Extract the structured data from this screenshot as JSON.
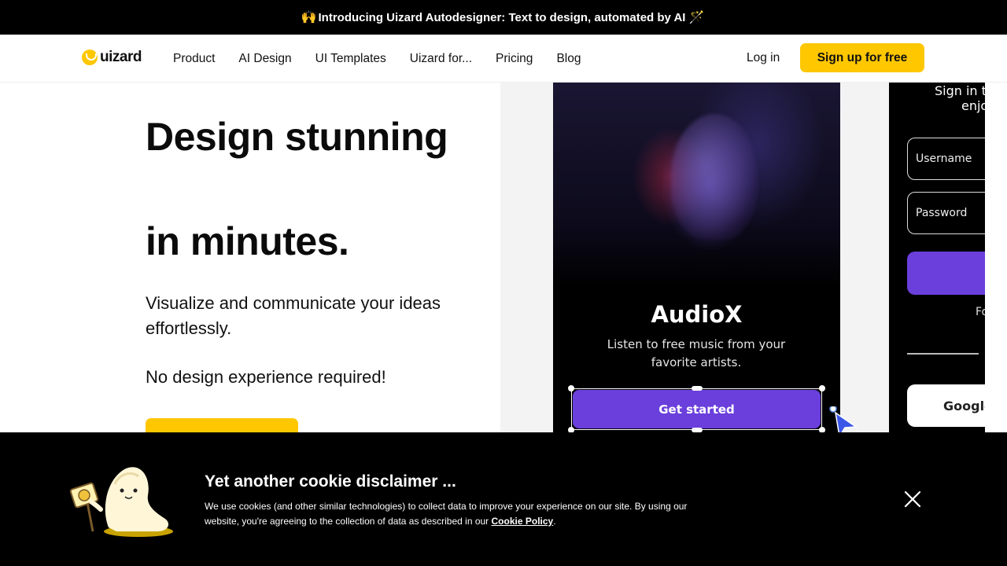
{
  "announcement": {
    "emoji": "🙌",
    "text": "Introducing Uizard Autodesigner: Text to design, automated by AI",
    "wand": "🪄"
  },
  "nav": {
    "logo_text": "uizard",
    "items": [
      "Product",
      "AI Design",
      "UI Templates",
      "Uizard for...",
      "Pricing",
      "Blog"
    ],
    "login": "Log in",
    "signup": "Sign up for free"
  },
  "hero": {
    "title_line1": "Design stunning",
    "title_line2": "in minutes.",
    "subtitle": "Visualize and communicate your ideas effortlessly.",
    "subtitle2": "No design experience required!"
  },
  "showcase": {
    "app_title": "AudioX",
    "app_sub": "Listen to free music from your favorite artists.",
    "app_button": "Get started",
    "signin_head": "Sign in t",
    "signin_head2": "enjo",
    "username": "Username",
    "password": "Password",
    "forgot": "Fo",
    "google": "Google"
  },
  "cookie": {
    "title": "Yet another cookie disclaimer ...",
    "text_before": "We use cookies (and other similar technologies) to collect data to improve your experience on our site. By using our website, you're agreeing to the collection of data as described in our ",
    "link": "Cookie Policy",
    "text_after": "."
  },
  "colors": {
    "brand_yellow": "#ffc700",
    "app_purple": "#6a3fdc",
    "banner_bg": "#000000"
  },
  "icons": [
    "logo-mark-icon",
    "cursor-arrow-icon",
    "close-icon",
    "seal-mascot-icon"
  ]
}
